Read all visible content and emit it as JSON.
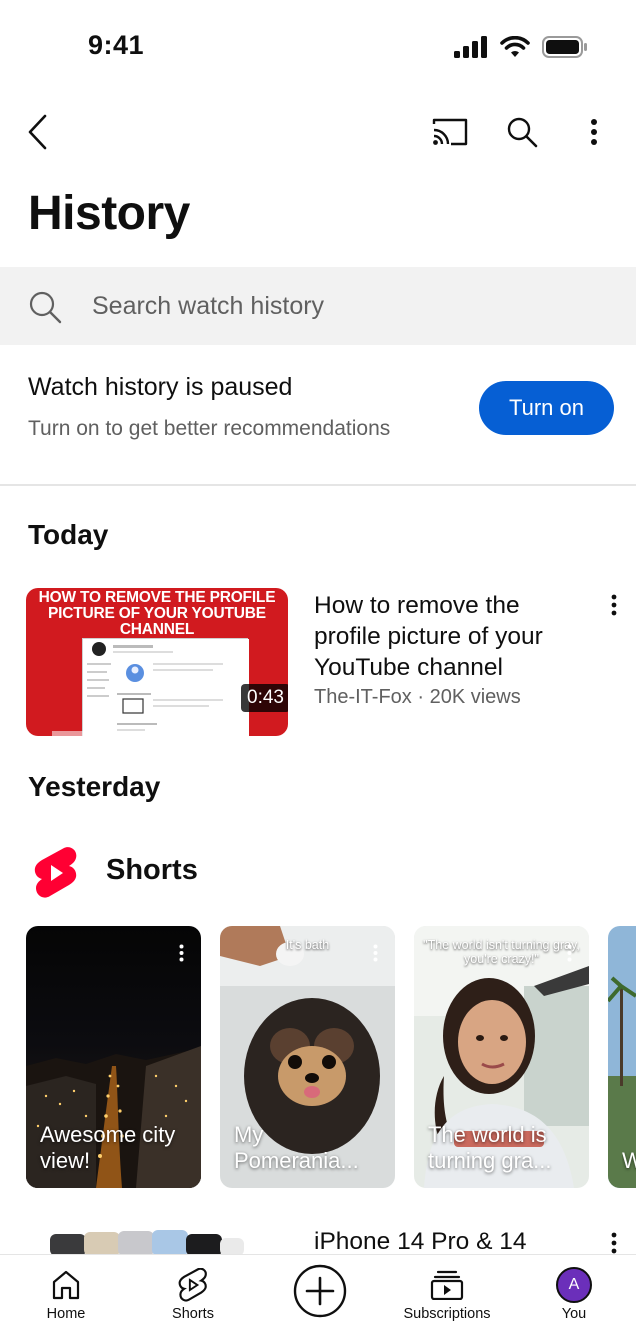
{
  "status_bar": {
    "time": "9:41"
  },
  "page": {
    "title": "History"
  },
  "search": {
    "placeholder": "Search watch history"
  },
  "notice": {
    "title": "Watch history is paused",
    "subtitle": "Turn on to get better recommendations",
    "button_label": "Turn on"
  },
  "sections": {
    "today": "Today",
    "yesterday": "Yesterday"
  },
  "today_videos": [
    {
      "thumbnail_text": "HOW TO REMOVE THE PROFILE PICTURE OF YOUR YOUTUBE CHANNEL",
      "duration": "0:43",
      "title": "How to remove the profile picture of your YouTube channel",
      "meta": "The-IT-Fox · 20K views"
    }
  ],
  "shorts": {
    "label": "Shorts",
    "items": [
      {
        "title": "Awesome city view!",
        "caption": ""
      },
      {
        "title": "My Pomerania...",
        "caption": "It's bath"
      },
      {
        "title": "The world is turning gra...",
        "caption": "\"The world isn't turning gray, you're crazy!\""
      },
      {
        "title": "W b",
        "caption": ""
      }
    ]
  },
  "next_row": {
    "title": "iPhone 14 Pro & 14"
  },
  "bottom_nav": {
    "home": "Home",
    "shorts": "Shorts",
    "subscriptions": "Subscriptions",
    "you": "You",
    "avatar_letter": "A"
  },
  "colors": {
    "accent": "#065fd4",
    "shorts_red": "#ff0033",
    "avatar": "#6b2fba",
    "thumbnail_red": "#d11a1f"
  }
}
